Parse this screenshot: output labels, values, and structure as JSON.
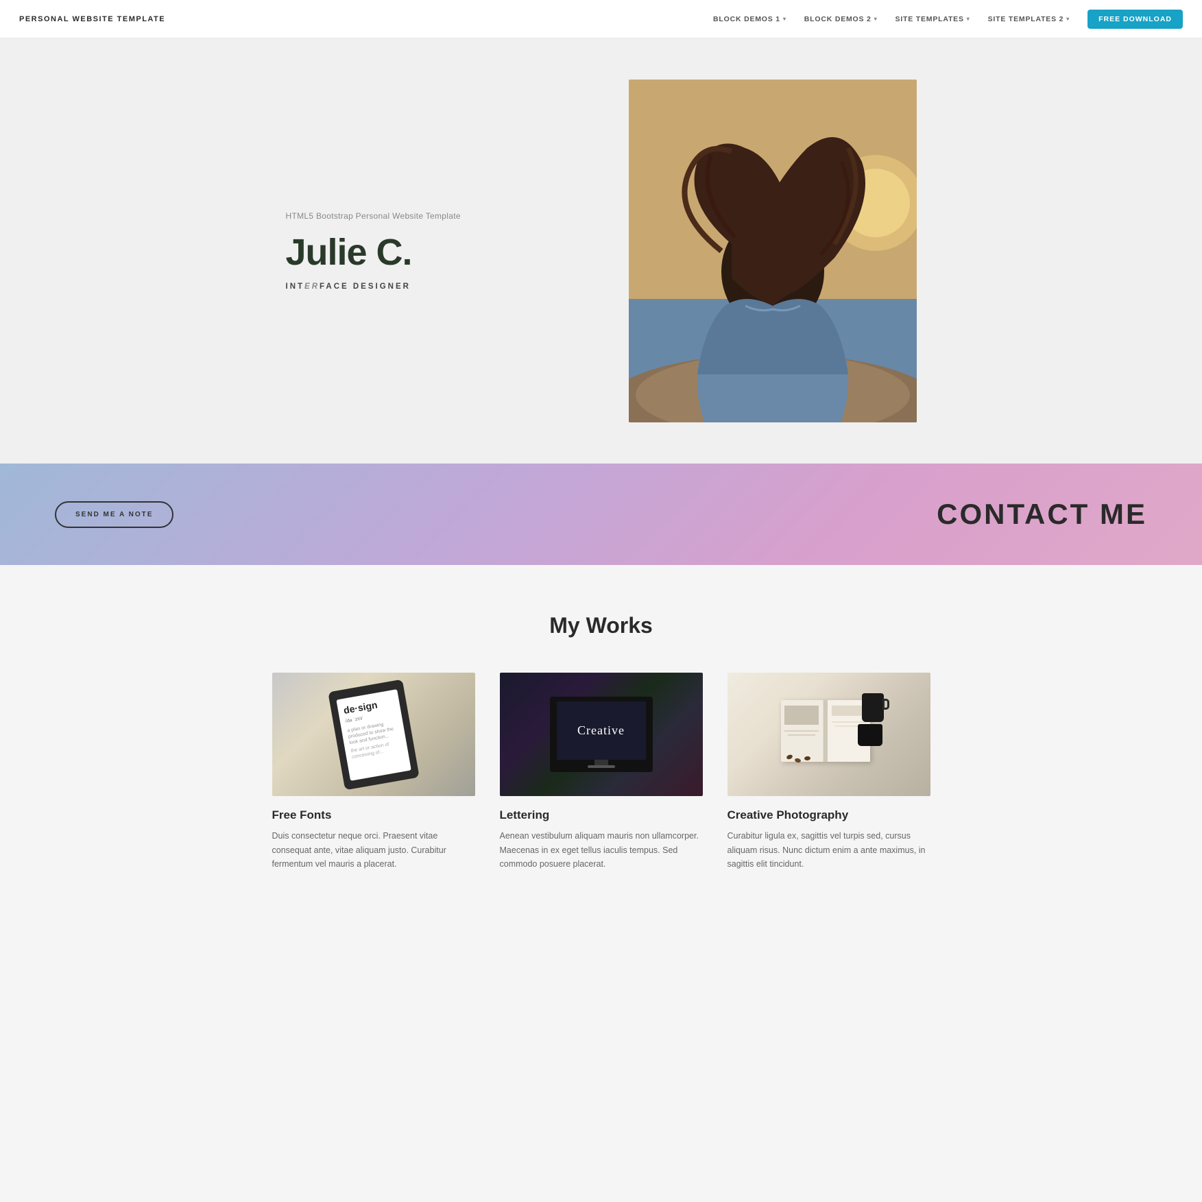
{
  "nav": {
    "brand": "PERSONAL WEBSITE TEMPLATE",
    "links": [
      {
        "label": "BLOCK DEMOS 1",
        "caret": "▾",
        "id": "block-demos-1"
      },
      {
        "label": "BLOCK DEMOS 2",
        "caret": "▾",
        "id": "block-demos-2"
      },
      {
        "label": "SITE TEMPLATES",
        "caret": "▾",
        "id": "site-templates"
      },
      {
        "label": "SITE TEMPLATES 2",
        "caret": "▾",
        "id": "site-templates-2"
      }
    ],
    "download_label": "FREE DOWNLOAD"
  },
  "hero": {
    "subtitle": "HTML5 Bootstrap Personal Website Template",
    "name": "Julie C.",
    "role_prefix": "INT",
    "role_italic": "ER",
    "role_suffix": "FACE DESIGNER"
  },
  "contact": {
    "btn_label": "SEND ME A NOTE",
    "title": "CONTACT ME"
  },
  "works": {
    "section_title": "My Works",
    "items": [
      {
        "title": "Free Fonts",
        "description": "Duis consectetur neque orci. Praesent vitae consequat ante, vitae aliquam justo. Curabitur fermentum vel mauris a placerat."
      },
      {
        "title": "Lettering",
        "description": "Aenean vestibulum aliquam mauris non ullamcorper. Maecenas in ex eget tellus iaculis tempus. Sed commodo posuere placerat."
      },
      {
        "title": "Creative Photography",
        "description": "Curabitur ligula ex, sagittis vel turpis sed, cursus aliquam risus. Nunc dictum enim a ante maximus, in sagittis elit tincidunt."
      }
    ]
  }
}
